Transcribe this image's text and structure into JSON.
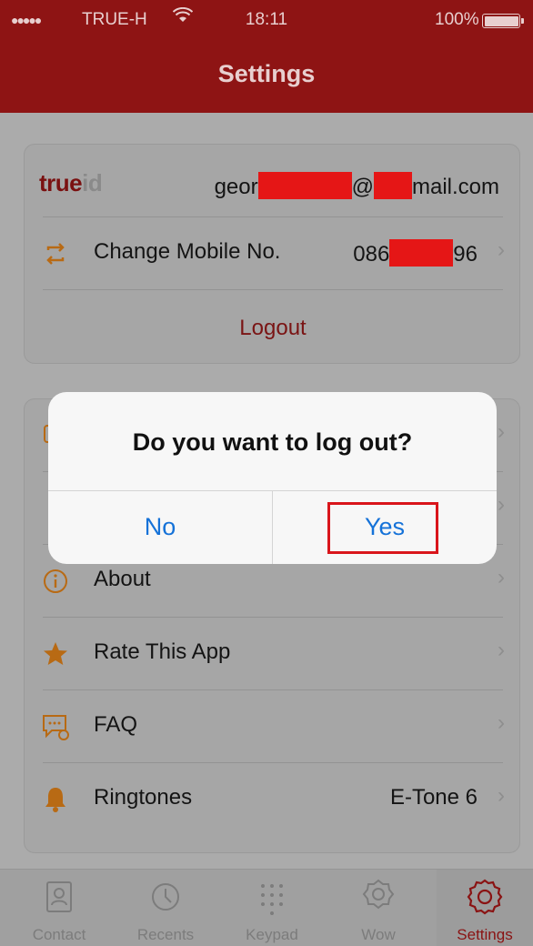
{
  "status_bar": {
    "signal_dots": "●●●●●",
    "carrier": "TRUE-H",
    "wifi_icon": "wifi-icon",
    "time": "18:11",
    "battery": "100%"
  },
  "header": {
    "title": "Settings"
  },
  "account": {
    "brand_prefix": "true",
    "brand_suffix": "id",
    "email_start": "geor",
    "email_at": "@",
    "email_end": "mail.com",
    "change_mobile_label": "Change Mobile No.",
    "mobile_start": "086",
    "mobile_end": "96",
    "logout_label": "Logout"
  },
  "settings_rows": [
    {
      "icon": "info-icon",
      "label": "About",
      "value": ""
    },
    {
      "icon": "star-icon",
      "label": "Rate This App",
      "value": ""
    },
    {
      "icon": "faq-icon",
      "label": "FAQ",
      "value": ""
    },
    {
      "icon": "bell-icon",
      "label": "Ringtones",
      "value": "E-Tone 6"
    }
  ],
  "dialog": {
    "message": "Do you want to log out?",
    "no_label": "No",
    "yes_label": "Yes"
  },
  "tabs": [
    {
      "icon": "contact-icon",
      "label": "Contact"
    },
    {
      "icon": "clock-icon",
      "label": "Recents"
    },
    {
      "icon": "keypad-icon",
      "label": "Keypad"
    },
    {
      "icon": "wow-icon",
      "label": "Wow"
    },
    {
      "icon": "gear-icon",
      "label": "Settings",
      "active": true
    }
  ],
  "colors": {
    "header": "#8e1414",
    "brand_red": "#7a1010",
    "dialog_button": "#1572d8",
    "highlight": "#d9151b",
    "redaction": "#e51616",
    "icon_orange": "#b86a14"
  }
}
